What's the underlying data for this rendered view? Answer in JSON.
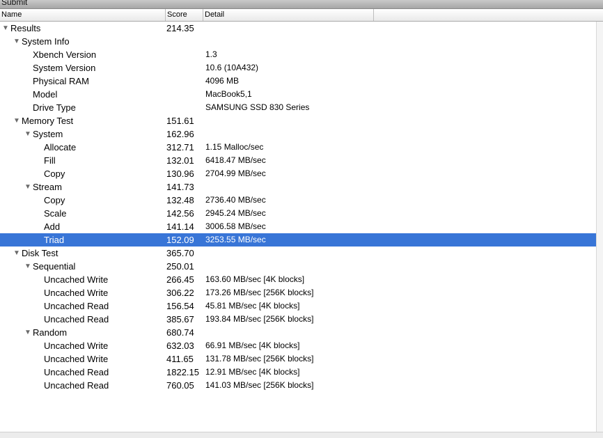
{
  "toolbar": {
    "submit_label": "Submit"
  },
  "columns": {
    "name": "Name",
    "score": "Score",
    "detail": "Detail"
  },
  "rows": [
    {
      "name": "Results",
      "score": "214.35",
      "detail": "",
      "expanded": true
    },
    {
      "name": "System Info",
      "score": "",
      "detail": "",
      "expanded": true
    },
    {
      "name": "Xbench Version",
      "score": "",
      "detail": "1.3"
    },
    {
      "name": "System Version",
      "score": "",
      "detail": "10.6 (10A432)"
    },
    {
      "name": "Physical RAM",
      "score": "",
      "detail": "4096 MB"
    },
    {
      "name": "Model",
      "score": "",
      "detail": "MacBook5,1"
    },
    {
      "name": "Drive Type",
      "score": "",
      "detail": "SAMSUNG SSD 830 Series"
    },
    {
      "name": "Memory Test",
      "score": "151.61",
      "detail": "",
      "expanded": true
    },
    {
      "name": "System",
      "score": "162.96",
      "detail": "",
      "expanded": true
    },
    {
      "name": "Allocate",
      "score": "312.71",
      "detail": "1.15 Malloc/sec"
    },
    {
      "name": "Fill",
      "score": "132.01",
      "detail": "6418.47 MB/sec"
    },
    {
      "name": "Copy",
      "score": "130.96",
      "detail": "2704.99 MB/sec"
    },
    {
      "name": "Stream",
      "score": "141.73",
      "detail": "",
      "expanded": true
    },
    {
      "name": "Copy",
      "score": "132.48",
      "detail": "2736.40 MB/sec"
    },
    {
      "name": "Scale",
      "score": "142.56",
      "detail": "2945.24 MB/sec"
    },
    {
      "name": "Add",
      "score": "141.14",
      "detail": "3006.58 MB/sec"
    },
    {
      "name": "Triad",
      "score": "152.09",
      "detail": "3253.55 MB/sec",
      "selected": true
    },
    {
      "name": "Disk Test",
      "score": "365.70",
      "detail": "",
      "expanded": true
    },
    {
      "name": "Sequential",
      "score": "250.01",
      "detail": "",
      "expanded": true
    },
    {
      "name": "Uncached Write",
      "score": "266.45",
      "detail": "163.60 MB/sec [4K blocks]"
    },
    {
      "name": "Uncached Write",
      "score": "306.22",
      "detail": "173.26 MB/sec [256K blocks]"
    },
    {
      "name": "Uncached Read",
      "score": "156.54",
      "detail": "45.81 MB/sec [4K blocks]"
    },
    {
      "name": "Uncached Read",
      "score": "385.67",
      "detail": "193.84 MB/sec [256K blocks]"
    },
    {
      "name": "Random",
      "score": "680.74",
      "detail": "",
      "expanded": true
    },
    {
      "name": "Uncached Write",
      "score": "632.03",
      "detail": "66.91 MB/sec [4K blocks]"
    },
    {
      "name": "Uncached Write",
      "score": "411.65",
      "detail": "131.78 MB/sec [256K blocks]"
    },
    {
      "name": "Uncached Read",
      "score": "1822.15",
      "detail": "12.91 MB/sec [4K blocks]"
    },
    {
      "name": "Uncached Read",
      "score": "760.05",
      "detail": "141.03 MB/sec [256K blocks]"
    }
  ],
  "colors": {
    "selection": "#3875d7",
    "disclosure": "#6a6a6a"
  },
  "icons": {
    "expanded": "disclosure-triangle-down-icon"
  }
}
